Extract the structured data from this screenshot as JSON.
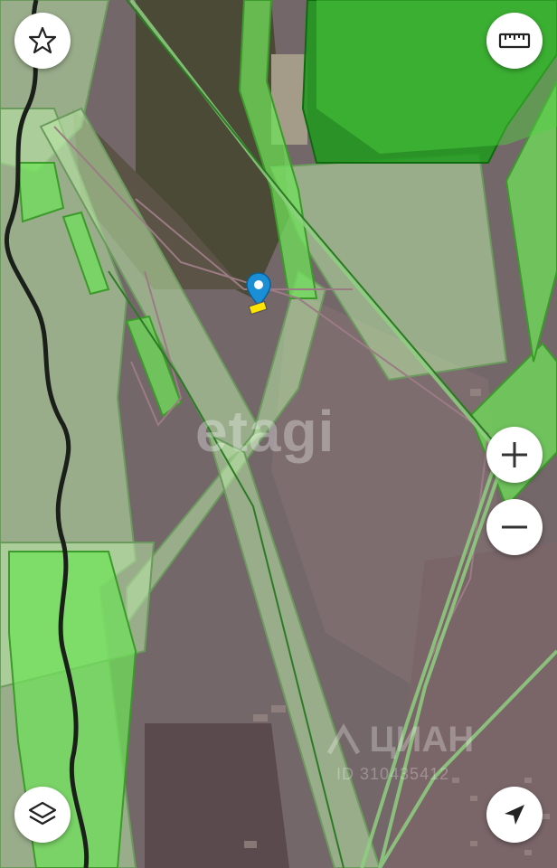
{
  "watermark": "etagi",
  "cian": {
    "brand": "ЦИАН",
    "id_text": "ID 310435412"
  },
  "controls": {
    "favorite": "star-icon",
    "ruler": "ruler-icon",
    "zoom_in": "plus-icon",
    "zoom_out": "minus-icon",
    "layers": "layers-icon",
    "locate": "navigation-arrow-icon"
  },
  "colors": {
    "zone_light": "#b9e7a6",
    "zone_bright": "#6fe05a",
    "zone_dark": "#1f9a1c",
    "plot_marker": "#ffe400",
    "pin": "#1a8fd6"
  }
}
